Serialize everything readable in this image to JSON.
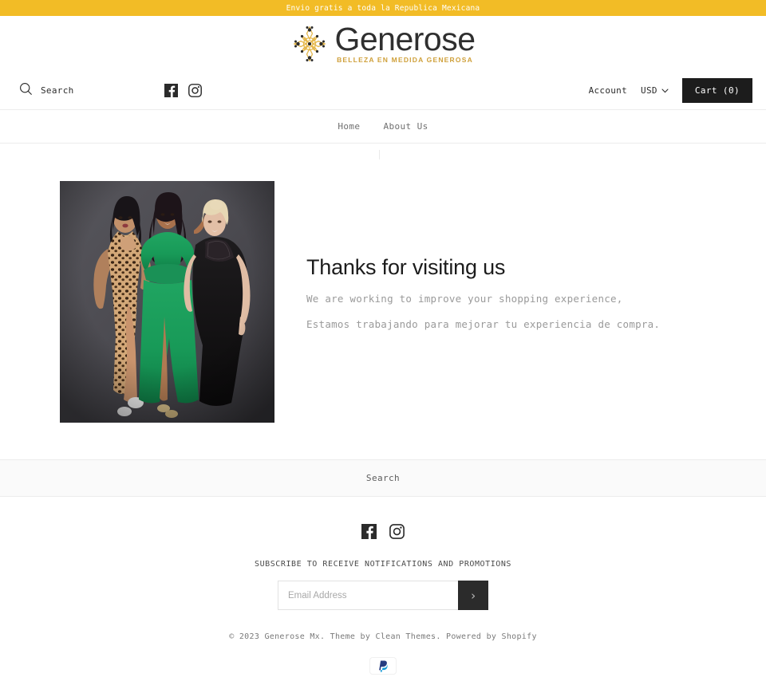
{
  "announcement": {
    "text": "Envio gratis a toda la Republica Mexicana",
    "background": "#f2bc26",
    "text_color": "#ffffff"
  },
  "logo": {
    "word": "Generose",
    "tagline": "BELLEZA EN MEDIDA GENEROSA",
    "mark": "mandala-ornament-icon",
    "word_color": "#2f2f2f",
    "tagline_color": "#cfa03a",
    "mark_color": "#e5b84b"
  },
  "header": {
    "search_label": "Search",
    "search_icon": "search-icon",
    "social": [
      {
        "name": "facebook-icon",
        "label": "Facebook"
      },
      {
        "name": "instagram-icon",
        "label": "Instagram"
      }
    ],
    "account_label": "Account",
    "currency_value": "USD",
    "currency_caret": "chevron-down-icon",
    "cart_label": "Cart (0)",
    "cart_count": 0,
    "cart_background": "#1c1c1c"
  },
  "nav": {
    "items": [
      {
        "label": "Home"
      },
      {
        "label": "About Us"
      }
    ]
  },
  "main": {
    "title": "Thanks for visiting us",
    "paragraph_en": "We are working to improve your shopping experience,",
    "paragraph_es": "Estamos trabajando para mejorar tu experiencia de compra.",
    "image_alt": "Three plus-size models in evening gowns - leopard print, green and black - on a dark gray studio backdrop"
  },
  "footer": {
    "links": [
      {
        "label": "Search"
      }
    ],
    "social": [
      {
        "name": "facebook-icon",
        "label": "Facebook"
      },
      {
        "name": "instagram-icon",
        "label": "Instagram"
      }
    ],
    "newsletter": {
      "heading": "SUBSCRIBE TO RECEIVE NOTIFICATIONS AND PROMOTIONS",
      "placeholder": "Email Address",
      "value": "",
      "submit_icon": "chevron-right-icon",
      "submit_glyph": "›"
    },
    "copyright": "© 2023 Generose Mx. Theme by Clean Themes. Powered by Shopify",
    "payment_methods": [
      {
        "name": "paypal-icon",
        "label": "PayPal"
      }
    ]
  }
}
